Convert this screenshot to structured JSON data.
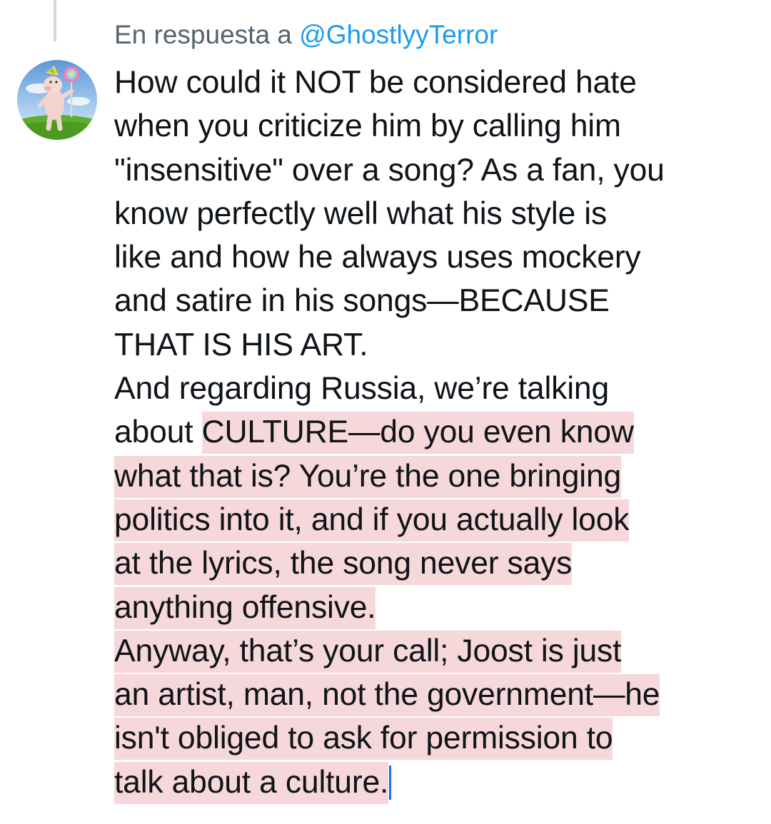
{
  "reply_to": {
    "prefix": "En respuesta a",
    "handle": "@GhostlyyTerror"
  },
  "tweet": {
    "lines": [
      "How could it NOT be considered hate",
      "when you criticize him by calling him",
      "\"insensitive\" over a song? As a fan, you",
      "know perfectly well what his style is",
      "like and how he always uses mockery",
      "and satire in his songs—BECAUSE",
      "THAT IS HIS ART.",
      "And regarding Russia, we’re talking",
      "about ",
      "CULTURE—do you even know",
      "what that is? You’re the one bringing",
      "politics into it, and if you actually look",
      "at the lyrics, the song never says",
      "anything offensive.",
      "Anyway, that’s your call; Joost is just",
      "an artist, man, not the government—he",
      "isn't obliged to ask for permission to",
      "talk about a culture."
    ]
  },
  "colors": {
    "highlight": "#f6d7da",
    "link": "#1d9bf0",
    "text": "#0f1419",
    "muted": "#536471"
  },
  "avatar": {
    "icon": "pig-with-lollipop-avatar"
  }
}
